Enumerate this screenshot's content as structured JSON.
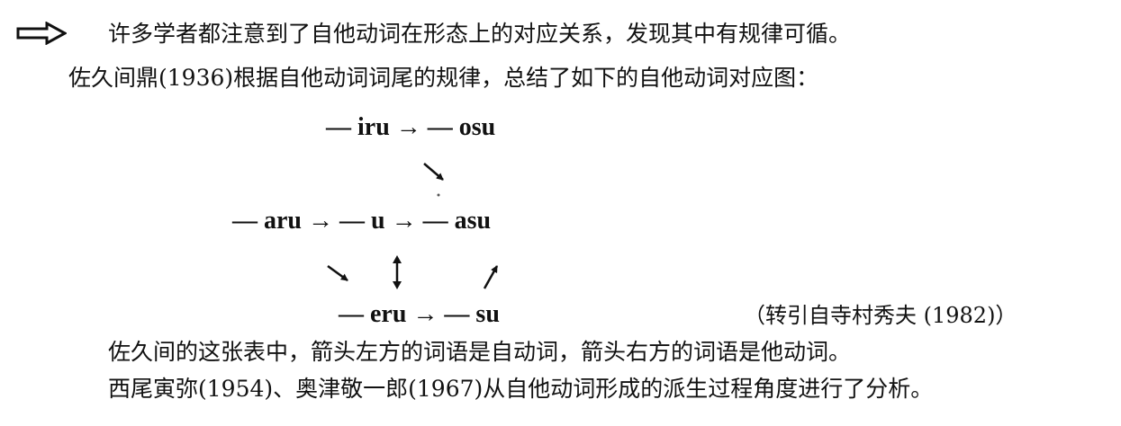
{
  "marker_icon": "hollow-right-arrow-icon",
  "text": {
    "line1": "许多学者都注意到了自他动词在形态上的对应关系，发现其中有规律可循。",
    "line2": "佐久间鼎(1936)根据自他动词词尾的规律，总结了如下的自他动词对应图：",
    "line6": "佐久间的这张表中，箭头左方的词语是自动词，箭头右方的词语是他动词。",
    "line7": "西尾寅弥(1954)、奥津敬一郎(1967)从自他动词形成的派生过程角度进行了分析。"
  },
  "diagram": {
    "row1": "— iru → — osu",
    "row2": "— aru → — u → — asu",
    "row3": "— eru → — su"
  },
  "citation": "（转引自寺村秀夫 (1982)）",
  "diagram_icons": [
    "arrow-down-right-icon",
    "arrow-down-right-icon",
    "double-vertical-arrow-icon",
    "arrow-up-right-icon"
  ]
}
